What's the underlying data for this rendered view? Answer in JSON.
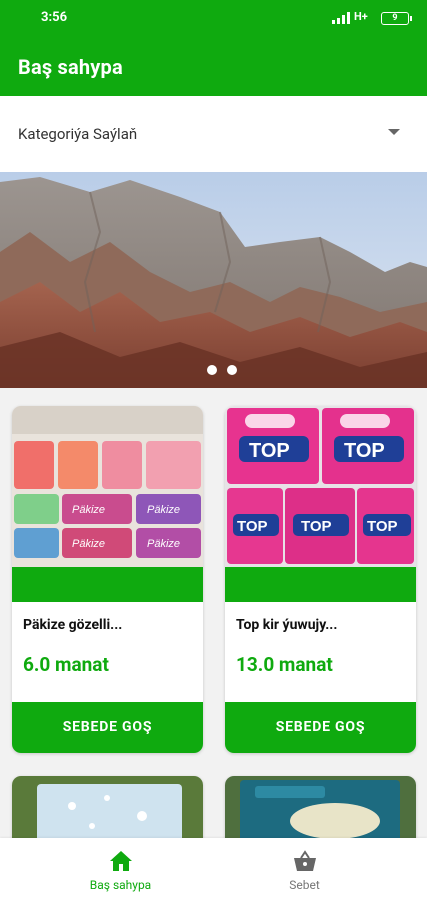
{
  "status_bar": {
    "time": "3:56",
    "network": "H+",
    "battery": "9"
  },
  "app_bar": {
    "title": "Baş sahypa"
  },
  "category_selector": {
    "label": "Kategoriýa Saýlaň"
  },
  "banner": {
    "slide_count": 2,
    "active_slide": 1
  },
  "products": [
    {
      "name": "Päkize gözelli...",
      "price": "6.0 manat",
      "button": "SEBEDE GOŞ"
    },
    {
      "name": "Top kir ýuwujy...",
      "price": "13.0 manat",
      "button": "SEBEDE GOŞ"
    }
  ],
  "bottom_nav": {
    "home": {
      "label": "Baş sahypa",
      "icon": "home-icon",
      "active": true
    },
    "cart": {
      "label": "Sebet",
      "icon": "basket-icon",
      "active": false
    }
  },
  "colors": {
    "primary": "#0faa0f",
    "background": "#f2f2f2"
  }
}
